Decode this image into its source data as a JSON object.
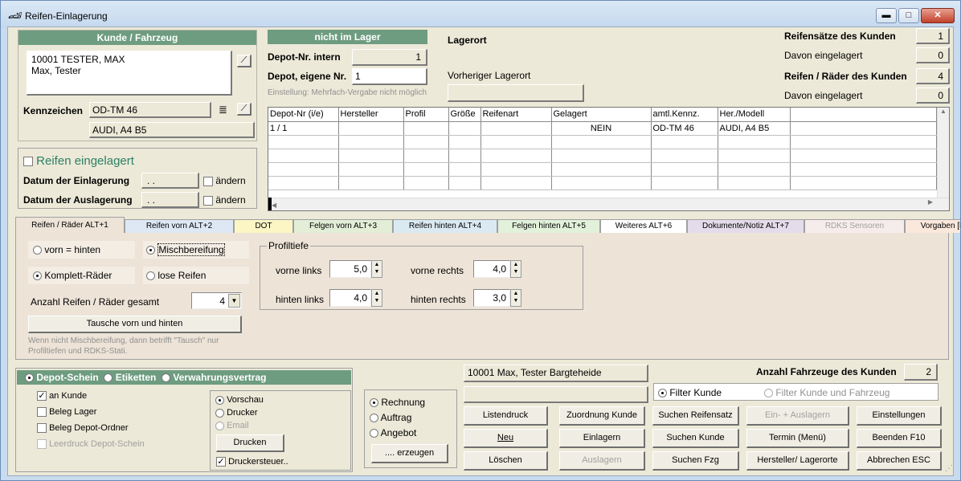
{
  "window": {
    "title": "Reifen-Einlagerung",
    "minimize": "▬",
    "maximize": "□",
    "close": "✕"
  },
  "kunde": {
    "header": "Kunde / Fahrzeug",
    "line1": "10001 TESTER, MAX",
    "line2": "Max, Tester",
    "kennzeichen_label": "Kennzeichen",
    "kennzeichen": "OD-TM 46",
    "fahrzeug": "AUDI, A4 B5"
  },
  "reifen_status": {
    "checkbox_label": "Reifen eingelagert",
    "einlagerung_label": "Datum der Einlagerung",
    "einlagerung_value": ". .",
    "auslagerung_label": "Datum der Auslagerung",
    "auslagerung_value": ". .",
    "aendern1": "ändern",
    "aendern2": "ändern"
  },
  "lager": {
    "status": "nicht im Lager",
    "depot_intern_label": "Depot-Nr. intern",
    "depot_intern": "1",
    "depot_eigene_label": "Depot, eigene Nr.",
    "depot_eigene": "1",
    "einstellung_note": "Einstellung: Mehrfach-Vergabe nicht möglich",
    "lagerort_label": "Lagerort",
    "vorheriger_label": "Vorheriger Lagerort"
  },
  "summary": {
    "saetze_label": "Reifensätze des Kunden",
    "saetze": "1",
    "saetze_eing_label": "Davon eingelagert",
    "saetze_eing": "0",
    "raeder_label": "Reifen / Räder des Kunden",
    "raeder": "4",
    "raeder_eing_label": "Davon eingelagert",
    "raeder_eing": "0"
  },
  "grid": {
    "columns": [
      "Depot-Nr (i/e)",
      "Hersteller",
      "Profil",
      "Größe",
      "Reifenart",
      "Gelagert",
      "amtl.Kennz.",
      "Her./Modell",
      ""
    ],
    "rows": [
      [
        "1 / 1",
        "",
        "",
        "",
        "",
        "NEIN",
        "OD-TM 46",
        "AUDI, A4 B5",
        ""
      ]
    ]
  },
  "tabs": [
    {
      "label": "Reifen / Räder ALT+1",
      "color": "#ece9d8"
    },
    {
      "label": "Reifen vorn ALT+2",
      "color": "#dde8f4"
    },
    {
      "label": "DOT",
      "color": "#fbf6c4"
    },
    {
      "label": "Felgen vorn ALT+3",
      "color": "#e2eed6"
    },
    {
      "label": "Reifen hinten ALT+4",
      "color": "#dbe9f2"
    },
    {
      "label": "Felgen hinten ALT+5",
      "color": "#e2f1da"
    },
    {
      "label": "Weiteres ALT+6",
      "color": "#ffffff"
    },
    {
      "label": "Dokumente/Notiz ALT+7",
      "color": "#e4dcea"
    },
    {
      "label": "RDKS Sensoren",
      "color": "#f6ecec"
    },
    {
      "label": "Vorgaben [bar]",
      "color": "#fbe8dc"
    }
  ],
  "tab1": {
    "vorn_hinten": "vorn = hinten",
    "misch": "Mischbereifung",
    "komplett": "Komplett-Räder",
    "lose": "lose Reifen",
    "anzahl_label": "Anzahl Reifen / Räder gesamt",
    "anzahl": "4",
    "tausche_button": "Tausche vorn und hinten",
    "note1": "Wenn nicht Mischbereifung, dann betrifft \"Tausch\" nur",
    "note2": "Profiltiefen und RDKS-Stati.",
    "profil_header": "Profiltiefe",
    "vl_label": "vorne links",
    "vl": "5,0",
    "vr_label": "vorne rechts",
    "vr": "4,0",
    "hl_label": "hinten links",
    "hl": "4,0",
    "hr_label": "hinten rechts",
    "hr": "3,0"
  },
  "print": {
    "depot": "Depot-Schein",
    "etiketten": "Etiketten",
    "vertrag": "Verwahrungsvertrag",
    "an_kunde": "an Kunde",
    "beleg_lager": "Beleg Lager",
    "beleg_ordner": "Beleg Depot-Ordner",
    "leerdruck": "Leerdruck Depot-Schein",
    "vorschau": "Vorschau",
    "drucker": "Drucker",
    "email": "Email",
    "drucken": "Drucken",
    "druckersteuer": "Druckersteuer.."
  },
  "doc": {
    "rechnung": "Rechnung",
    "auftrag": "Auftrag",
    "angebot": "Angebot",
    "erzeugen": ".... erzeugen"
  },
  "bottom": {
    "customer_line": "10001 Max, Tester Bargteheide",
    "anzahl_label": "Anzahl Fahrzeuge des Kunden",
    "anzahl": "2",
    "filter_kunde": "Filter Kunde",
    "filter_kf": "Filter Kunde und Fahrzeug"
  },
  "buttons": {
    "listendruck": "Listendruck",
    "zuordnung": "Zuordnung Kunde",
    "suchen_satz": "Suchen Reifensatz",
    "ein_aus": "Ein- + Auslagern",
    "einstellungen": "Einstellungen",
    "neu": "Neu",
    "einlagern": "Einlagern",
    "suchen_kunde": "Suchen Kunde",
    "termin": "Termin (Menü)",
    "beenden": "Beenden F10",
    "loeschen": "Löschen",
    "auslagern": "Auslagern",
    "suchen_fzg": "Suchen Fzg",
    "hersteller": "Hersteller/ Lagerorte",
    "abbrechen": "Abbrechen ESC"
  }
}
